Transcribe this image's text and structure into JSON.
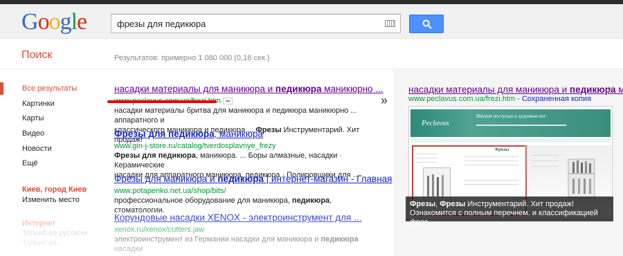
{
  "header": {
    "logo": [
      "G",
      "o",
      "o",
      "g",
      "l",
      "e"
    ],
    "search_value": "фрезы для педикюра",
    "keyboard_icon": "keyboard-icon",
    "search_button_icon": "magnifier-icon"
  },
  "subheader": {
    "label": "Поиск",
    "stats": "Результатов: примерно 1 080 000 (0,18 сек.)"
  },
  "nav": {
    "items": [
      {
        "label": "Все результаты",
        "active": true
      },
      {
        "label": "Картинки"
      },
      {
        "label": "Карты"
      },
      {
        "label": "Видео"
      },
      {
        "label": "Новости"
      },
      {
        "label": "Ещё"
      }
    ],
    "location_title": "Киев, город Киев",
    "location_change": "Изменить место",
    "faded_title": "Интернет",
    "faded_items": [
      "Только на русском",
      "Только на ..."
    ]
  },
  "results": [
    {
      "title_parts": [
        "насадки материалы для маникюра и ",
        "педикюра",
        " маникюрно ..."
      ],
      "url": "www.peclavus.com.ua/frezi.htm",
      "snippet_1": "насадки материалы бритва для маникюра и педикюра маникюрно ... аппаратного и",
      "snippet_2_parts": [
        "классического маникюра и педикюра ... ",
        "Фрезы",
        " Инструментарий. Хит продаж!"
      ]
    },
    {
      "title_parts": [
        "Фрезы для педикюра",
        ", маникюра"
      ],
      "url": "www.gin-j-store.ru/catalog/tverdosplavnye_frezy",
      "snippet_1_parts": [
        "Фрезы для педикюра",
        ", маникюра. ... Боры алмазные, насадки · Керамические"
      ],
      "snippet_2": "насадки для аппаратного маникюра, педикюра · Полировщики для ..."
    },
    {
      "title_parts": [
        "Фрезы для маникюра и ",
        "педикюра",
        " | интернет-магазин - Главная"
      ],
      "url": "www.potapenko.net.ua/shop/bits/",
      "snippet_1_parts": [
        "профессиональное оборудование для маникюра, ",
        "педикюра",
        ", стоматологии."
      ]
    },
    {
      "title": "Корундовые насадки XENOX - электроинструмент для ...",
      "url": "xenox.ru/xenox/cutters.jaw",
      "snippet_1_parts": [
        "электроинструмент из Германии насадки для маникюра и ",
        "педикюра",
        " насадки"
      ],
      "snippet_2": "..."
    }
  ],
  "preview": {
    "title_parts": [
      "насадки материалы для маникюра и ",
      "педикюра",
      " маникюрно ..."
    ],
    "close_icon": "close-icon",
    "url": "www.peclavus.com.ua/frezi.htm",
    "url_sep": " - ",
    "cached": "Сохраненная копия",
    "site_brand": "Peclavus",
    "site_slogan": "Мягкой поступью к здоровью ног",
    "site_heading": "Фрезы",
    "caption_parts": [
      "Фрезы",
      ", ",
      "Фрезы",
      " Инструментарий. Хит продаж! Ознакомится с полным перечнем. и классификацией фрез, ..."
    ]
  },
  "colors": {
    "accent_red": "#dd4b39",
    "link_blue": "#1122cc",
    "visited_purple": "#660099",
    "url_green": "#009933",
    "button_blue": "#4d90fe"
  }
}
